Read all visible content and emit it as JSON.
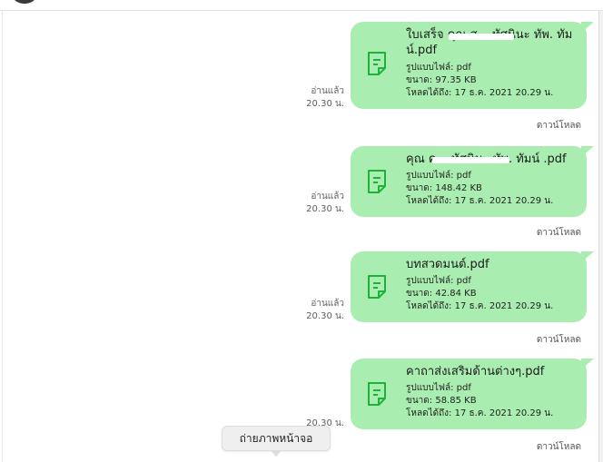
{
  "messages": [
    {
      "read_label": "อ่านแล้ว",
      "time": "20.30 น.",
      "file_name": "ใบเสร็จ คุณ ส... ทัศนินะ ทัพ. ทัม น์.pdf",
      "file_type": "รูปแบบไฟล์: pdf",
      "size": "ขนาด: 97.35 KB",
      "expiry": "โหลดได้ถึง: 17 ธ.ค. 2021 20.29 น.",
      "download": "ดาวน์โหลด"
    },
    {
      "read_label": "อ่านแล้ว",
      "time": "20.30 น.",
      "file_name": "คุณ ค... ทัศนินะ ทัพ. ทัมน์ .pdf",
      "file_type": "รูปแบบไฟล์: pdf",
      "size": "ขนาด: 148.42 KB",
      "expiry": "โหลดได้ถึง: 17 ธ.ค. 2021 20.29 น.",
      "download": "ดาวน์โหลด"
    },
    {
      "read_label": "อ่านแล้ว",
      "time": "20.30 น.",
      "file_name": "บทสวดมนต์.pdf",
      "file_type": "รูปแบบไฟล์: pdf",
      "size": "ขนาด: 42.84 KB",
      "expiry": "โหลดได้ถึง: 17 ธ.ค. 2021 20.29 น.",
      "download": "ดาวน์โหลด"
    },
    {
      "read_label": "",
      "time": "20.30 น.",
      "file_name": "คาถาส่งเสริมด้านต่างๆ.pdf",
      "file_type": "รูปแบบไฟล์: pdf",
      "size": "ขนาด: 58.85 KB",
      "expiry": "โหลดได้ถึง: 17 ธ.ค. 2021 20.29 น.",
      "download": "ดาวน์โหลด"
    }
  ],
  "tooltip": "ถ่ายภาพหน้าจอ",
  "colors": {
    "bubble": "#a9eeb0",
    "file_icon": "#1db33a"
  }
}
